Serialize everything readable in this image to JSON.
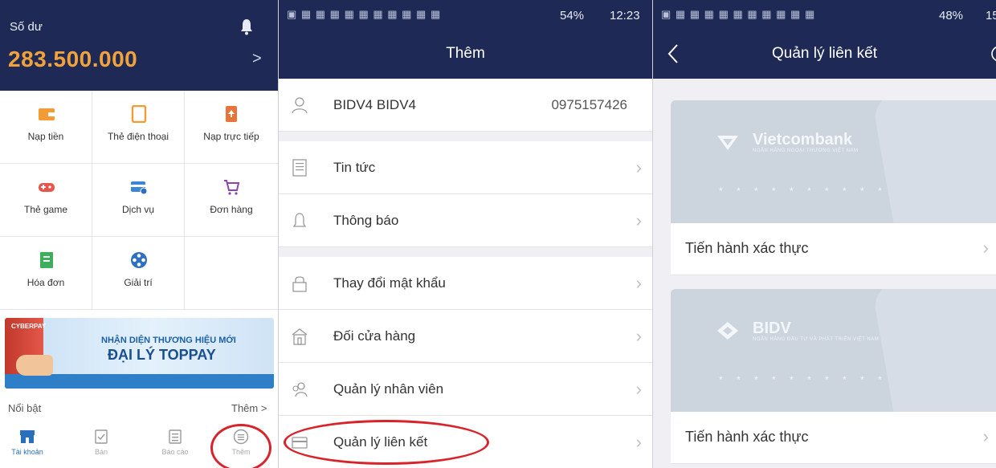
{
  "panel1": {
    "balance_label": "Số dư",
    "balance_amount": "283.500.000",
    "balance_chevron": ">",
    "grid": [
      {
        "label": "Nạp tiền",
        "icon": "wallet-icon",
        "color": "#f39c35"
      },
      {
        "label": "Thẻ điện thoại",
        "icon": "phone-icon",
        "color": "#f39c35"
      },
      {
        "label": "Nạp trực tiếp",
        "icon": "topup-phone-icon",
        "color": "#e9743a"
      },
      {
        "label": "Thẻ game",
        "icon": "gamepad-icon",
        "color": "#e8564b"
      },
      {
        "label": "Dịch vụ",
        "icon": "card-service-icon",
        "color": "#3b86d6"
      },
      {
        "label": "Đơn hàng",
        "icon": "cart-icon",
        "color": "#8e44ad"
      },
      {
        "label": "Hóa đơn",
        "icon": "bill-icon",
        "color": "#3cae5c"
      },
      {
        "label": "Giải trí",
        "icon": "film-reel-icon",
        "color": "#2e6fc2"
      }
    ],
    "banner": {
      "brand": "CYBERPAY",
      "line1": "NHẬN DIỆN THƯƠNG HIỆU MỚI",
      "line2": "ĐẠI LÝ TOPPAY"
    },
    "featured_label": "Nổi bật",
    "more_link": "Thêm >",
    "tabs": [
      {
        "label": "Tài khoản",
        "icon": "store-icon",
        "active": true
      },
      {
        "label": "Bán",
        "icon": "checklist-icon",
        "active": false
      },
      {
        "label": "Báo cáo",
        "icon": "report-icon",
        "active": false
      },
      {
        "label": "Thêm",
        "icon": "more-menu-icon",
        "active": false
      }
    ]
  },
  "panel2": {
    "status_time": "12:23",
    "status_battery": "54%",
    "title": "Thêm",
    "profile": {
      "name": "BIDV4 BIDV4",
      "phone": "0975157426"
    },
    "menu": [
      {
        "label": "Tin tức",
        "icon": "news-icon"
      },
      {
        "label": "Thông báo",
        "icon": "bell-outline-icon"
      },
      {
        "label": "Thay đổi mật khẩu",
        "icon": "lock-icon"
      },
      {
        "label": "Đối cửa hàng",
        "icon": "shop-icon"
      },
      {
        "label": "Quản lý nhân viên",
        "icon": "staff-icon"
      },
      {
        "label": "Quản lý liên kết",
        "icon": "link-card-icon"
      }
    ]
  },
  "panel3": {
    "status_battery": "48%",
    "status_time": "15",
    "title": "Quản lý liên kết",
    "cards": [
      {
        "bank": "Vietcombank",
        "subtitle": "NGÂN HÀNG NGOẠI THƯƠNG VIỆT NAM",
        "masked": "* * * * * * * * * *",
        "action": "Tiến hành xác thực"
      },
      {
        "bank": "BIDV",
        "subtitle": "NGÂN HÀNG ĐẦU TƯ VÀ PHÁT TRIỂN VIỆT NAM",
        "masked": "* * * * * * * * * *",
        "action": "Tiến hành xác thực"
      }
    ]
  },
  "colors": {
    "navy": "#1e2a55",
    "orange": "#f2a23a",
    "highlight": "#d8232a"
  }
}
